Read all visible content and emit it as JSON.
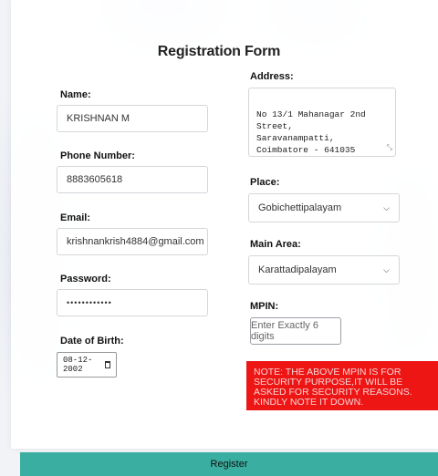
{
  "form": {
    "title": "Registration Form",
    "name": {
      "label": "Name:",
      "value": "KRISHNAN M"
    },
    "phone": {
      "label": "Phone Number:",
      "value": "8883605618"
    },
    "email": {
      "label": "Email:",
      "value": "krishnankrish4884@gmail.com"
    },
    "password": {
      "label": "Password:",
      "value": "••••••••••••"
    },
    "dob": {
      "label": "Date of Birth:",
      "value": "08-12-2002"
    },
    "address": {
      "label": "Address:",
      "value": "No 13/1 Mahanagar 2nd Street,\nSaravanampatti,\nCoimbatore - 641035"
    },
    "place": {
      "label": "Place:",
      "value": "Gobichettipalayam"
    },
    "main_area": {
      "label": "Main Area:",
      "value": "Karattadipalayam"
    },
    "mpin": {
      "label": "MPIN:",
      "placeholder": "Enter Exactly 6 digits"
    },
    "note": "NOTE: THE ABOVE MPIN IS FOR SECURITY PURPOSE,IT WILL BE ASKED FOR SECURITY REASONS. KINDLY NOTE IT DOWN.",
    "register_label": "Register"
  },
  "icons": {
    "select_caret": "chevron-down-icon",
    "calendar": "calendar-icon",
    "resize": "resize-handle-icon"
  },
  "colors": {
    "note_bg": "#ee1515",
    "register_bg": "#3aaea0"
  }
}
